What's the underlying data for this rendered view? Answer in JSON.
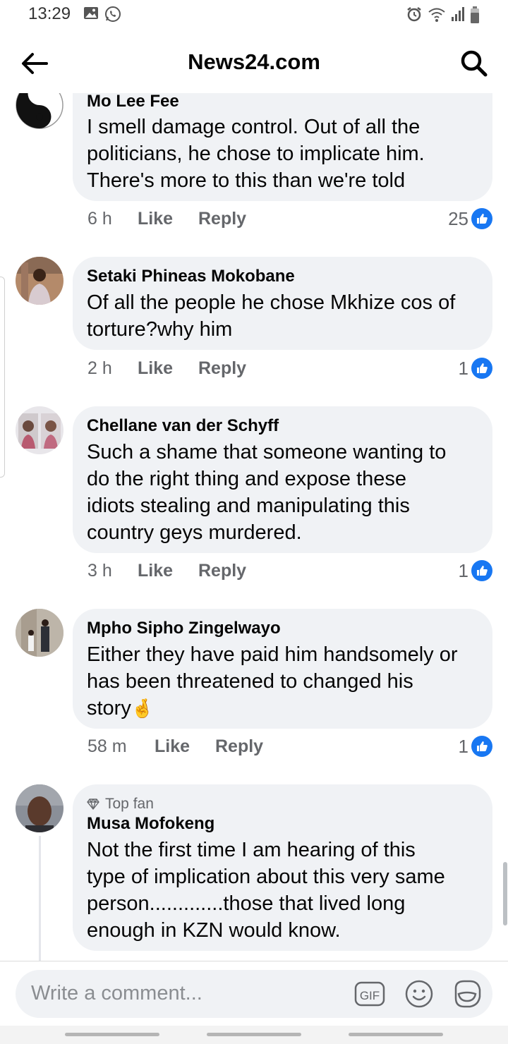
{
  "status_bar": {
    "time": "13:29"
  },
  "header": {
    "title": "News24.com"
  },
  "comments": [
    {
      "name": "Mo Lee Fee",
      "text": "I smell damage control. Out of all the\npoliticians, he chose to implicate him.\nThere's more to this than we're told",
      "time": "6 h",
      "like": "Like",
      "reply": "Reply",
      "reactions": "25"
    },
    {
      "name": "Setaki Phineas Mokobane",
      "text": "Of all the people he chose Mkhize cos of\ntorture?why him",
      "time": "2 h",
      "like": "Like",
      "reply": "Reply",
      "reactions": "1"
    },
    {
      "name": "Chellane van der Schyff",
      "text": "Such a shame that someone wanting to\ndo the right thing and expose these\nidiots stealing and manipulating this\ncountry geys murdered.",
      "time": "3 h",
      "like": "Like",
      "reply": "Reply",
      "reactions": "1"
    },
    {
      "name": "Mpho Sipho Zingelwayo",
      "text": "Either they have paid him handsomely or\nhas been threatened to changed his\nstory",
      "emoji": "🤞",
      "time": "58 m",
      "like": "Like",
      "reply": "Reply",
      "reactions": "1"
    },
    {
      "badge": "Top fan",
      "name": "Musa Mofokeng",
      "text": "Not the first time I am hearing of this\ntype of implication about this very same\nperson.............those that lived long\nenough in KZN would know."
    }
  ],
  "composer": {
    "placeholder": "Write a comment...",
    "gif_label": "GIF"
  },
  "colors": {
    "accent": "#1877f2",
    "bubble": "#f0f2f5",
    "meta": "#65676b"
  }
}
